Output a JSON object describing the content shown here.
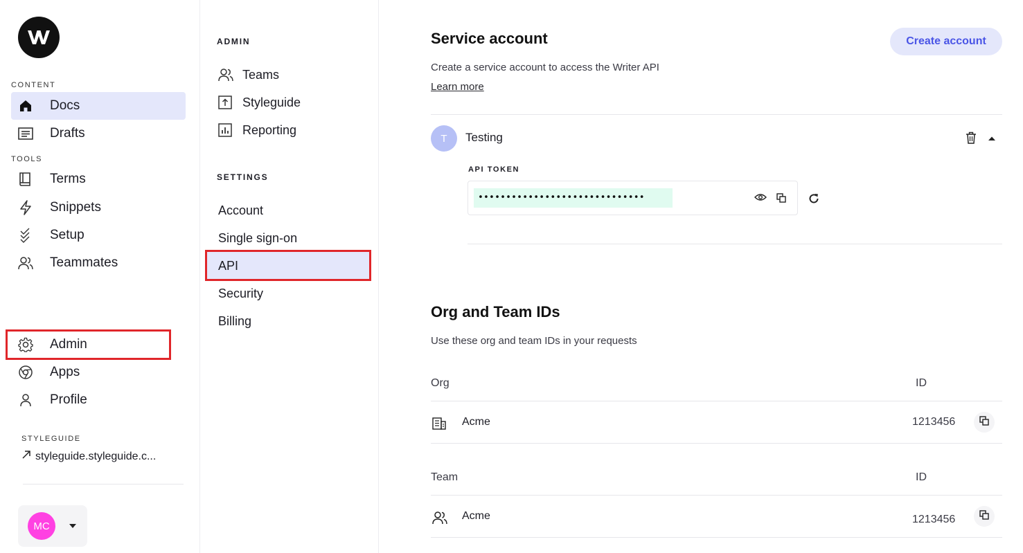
{
  "sidebar": {
    "content_label": "CONTENT",
    "tools_label": "TOOLS",
    "items": [
      {
        "label": "Docs",
        "icon": "home-icon"
      },
      {
        "label": "Drafts",
        "icon": "drafts-icon"
      },
      {
        "label": "Terms",
        "icon": "book-icon"
      },
      {
        "label": "Snippets",
        "icon": "bolt-icon"
      },
      {
        "label": "Setup",
        "icon": "checks-icon"
      },
      {
        "label": "Teammates",
        "icon": "people-icon"
      },
      {
        "label": "Admin",
        "icon": "gear-icon"
      },
      {
        "label": "Apps",
        "icon": "chrome-icon"
      },
      {
        "label": "Profile",
        "icon": "user-icon"
      }
    ],
    "styleguide_label": "STYLEGUIDE",
    "styleguide_link": "styleguide.styleguide.c...",
    "user_initials": "MC"
  },
  "admin_nav": {
    "admin_label": "ADMIN",
    "admin_items": [
      "Teams",
      "Styleguide",
      "Reporting"
    ],
    "settings_label": "SETTINGS",
    "settings_items": [
      "Account",
      "Single sign-on",
      "API",
      "Security",
      "Billing"
    ],
    "active_setting": "API"
  },
  "service_account": {
    "title": "Service account",
    "subtitle": "Create a service account to access the Writer API",
    "learn_more": "Learn more",
    "create_button": "Create account",
    "account": {
      "initial": "T",
      "name": "Testing",
      "token_label": "API TOKEN",
      "token_masked": "••••••••••••••••••••••••••••••"
    }
  },
  "ids": {
    "title": "Org and Team IDs",
    "subtitle": "Use these org and team IDs in your requests",
    "org_header": "Org",
    "team_header": "Team",
    "id_header": "ID",
    "org_row": {
      "name": "Acme",
      "id": "1213456"
    },
    "team_row": {
      "name": "Acme",
      "id": "1213456"
    }
  },
  "colors": {
    "accent": "#4a55e6",
    "active_bg": "#e4e7fb",
    "highlight": "#e0262a",
    "token_bg": "#e0fbf0",
    "user_avatar": "#ff41e2"
  }
}
